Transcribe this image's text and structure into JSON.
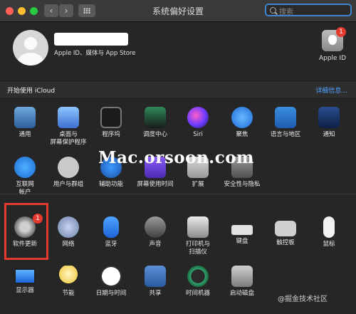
{
  "window": {
    "title": "系统偏好设置"
  },
  "search": {
    "placeholder": "搜索"
  },
  "account": {
    "subtitle": "Apple ID、媒体与 App Store",
    "appleid_label": "Apple ID",
    "appleid_badge": "1"
  },
  "icloud": {
    "prompt": "开始使用 iCloud",
    "details": "详细信息..."
  },
  "rows": [
    [
      {
        "label": "通用",
        "icon": "general-icon"
      },
      {
        "label": "桌面与\n屏幕保护程序",
        "icon": "desktop-icon"
      },
      {
        "label": "程序坞",
        "icon": "dock-icon"
      },
      {
        "label": "调度中心",
        "icon": "mission-control-icon"
      },
      {
        "label": "Siri",
        "icon": "siri-icon"
      },
      {
        "label": "聚焦",
        "icon": "spotlight-icon"
      },
      {
        "label": "语言与地区",
        "icon": "language-icon"
      },
      {
        "label": "通知",
        "icon": "notifications-icon"
      }
    ],
    [
      {
        "label": "互联网\n帐户",
        "icon": "internet-accounts-icon"
      },
      {
        "label": "用户与群组",
        "icon": "users-icon"
      },
      {
        "label": "辅助功能",
        "icon": "accessibility-icon"
      },
      {
        "label": "屏幕使用时间",
        "icon": "screen-time-icon"
      },
      {
        "label": "扩展",
        "icon": "extensions-icon"
      },
      {
        "label": "安全性与隐私",
        "icon": "security-icon"
      }
    ],
    [
      {
        "label": "软件更新",
        "icon": "software-update-icon",
        "badge": "1"
      },
      {
        "label": "网络",
        "icon": "network-icon"
      },
      {
        "label": "蓝牙",
        "icon": "bluetooth-icon"
      },
      {
        "label": "声音",
        "icon": "sound-icon"
      },
      {
        "label": "打印机与\n扫描仪",
        "icon": "printer-icon"
      },
      {
        "label": "键盘",
        "icon": "keyboard-icon"
      },
      {
        "label": "触控板",
        "icon": "trackpad-icon"
      },
      {
        "label": "鼠标",
        "icon": "mouse-icon"
      }
    ],
    [
      {
        "label": "显示器",
        "icon": "displays-icon"
      },
      {
        "label": "节能",
        "icon": "energy-saver-icon"
      },
      {
        "label": "日期与时间",
        "icon": "date-time-icon"
      },
      {
        "label": "共享",
        "icon": "sharing-icon"
      },
      {
        "label": "时间机器",
        "icon": "time-machine-icon"
      },
      {
        "label": "启动磁盘",
        "icon": "startup-disk-icon"
      }
    ]
  ],
  "watermark": "Mac.orsoon.com",
  "watermark2": "@掘金技术社区"
}
